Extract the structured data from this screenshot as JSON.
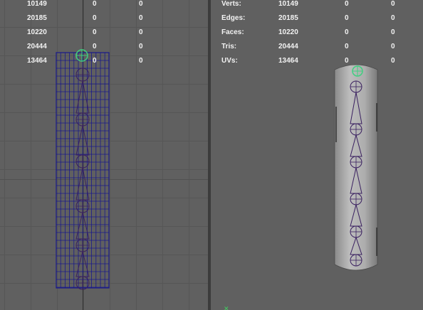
{
  "left_viewport": {
    "stats": [
      {
        "count": "10149",
        "a": "0",
        "b": "0"
      },
      {
        "count": "20185",
        "a": "0",
        "b": "0"
      },
      {
        "count": "10220",
        "a": "0",
        "b": "0"
      },
      {
        "count": "20444",
        "a": "0",
        "b": "0"
      },
      {
        "count": "13464",
        "a": "0",
        "b": "0"
      }
    ]
  },
  "right_viewport": {
    "stats": [
      {
        "label": "Verts:",
        "count": "10149",
        "a": "0",
        "b": "0"
      },
      {
        "label": "Edges:",
        "count": "20185",
        "a": "0",
        "b": "0"
      },
      {
        "label": "Faces:",
        "count": "10220",
        "a": "0",
        "b": "0"
      },
      {
        "label": "Tris:",
        "count": "20444",
        "a": "0",
        "b": "0"
      },
      {
        "label": "UVs:",
        "count": "13464",
        "a": "0",
        "b": "0"
      }
    ]
  },
  "colors": {
    "viewport_bg": "#606060",
    "wireframe": "#1a1a8a",
    "joints": "#3a2060",
    "selected_manipulator": "#40d080"
  },
  "icons": [
    "joint-root-manipulator-icon",
    "axis-gizmo-icon"
  ]
}
